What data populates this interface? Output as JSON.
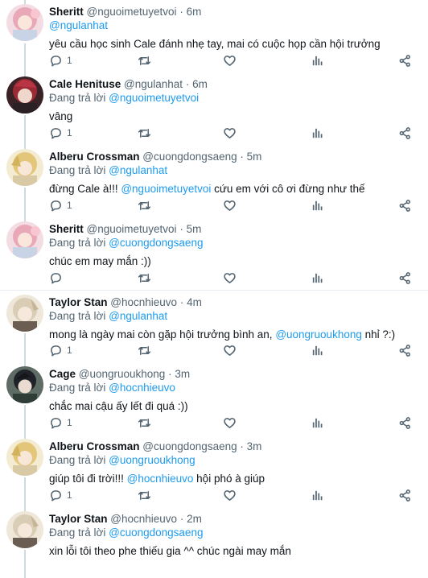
{
  "tweets": [
    {
      "name": "Sheritt",
      "handle": "@nguoimetuyetvoi",
      "time": "6m",
      "reply_prefix": "",
      "reply_to": "@ngulanhat",
      "text_parts": [
        "yêu cầu  học sinh Cale đánh nhẹ tay, mai có cuộc họp cần hội trưởng"
      ],
      "reply_count": "1",
      "avatar": "pink-haired-avatar"
    },
    {
      "name": "Cale Henituse",
      "handle": "@ngulanhat",
      "time": "6m",
      "reply_prefix": "Đang trả lời",
      "reply_to": "@nguoimetuyetvoi",
      "text_parts": [
        "vâng"
      ],
      "reply_count": "1",
      "avatar": "red-haired-avatar"
    },
    {
      "name": "Alberu Crossman",
      "handle": "@cuongdongsaeng",
      "time": "5m",
      "reply_prefix": "Đang trả lời",
      "reply_to": "@ngulanhat",
      "text_parts": [
        "đừng Cale à!!! ",
        "@nguoimetuyetvoi",
        " cứu em với cô ơi đừng như thế"
      ],
      "reply_count": "1",
      "avatar": "blonde-avatar"
    },
    {
      "name": "Sheritt",
      "handle": "@nguoimetuyetvoi",
      "time": "5m",
      "reply_prefix": "Đang trả lời",
      "reply_to": "@cuongdongsaeng",
      "text_parts": [
        "chúc em may mắn :))"
      ],
      "reply_count": "",
      "avatar": "pink-haired-avatar"
    },
    {
      "name": "Taylor Stan",
      "handle": "@hocnhieuvo",
      "time": "4m",
      "reply_prefix": "Đang trả lời",
      "reply_to": "@ngulanhat",
      "text_parts": [
        "mong là ngày mai còn gặp hội trưởng bình an, ",
        "@uongruoukhong",
        " nhỉ ?:)"
      ],
      "reply_count": "1",
      "avatar": "light-haired-avatar"
    },
    {
      "name": "Cage",
      "handle": "@uongruoukhong",
      "time": "3m",
      "reply_prefix": "Đang trả lời",
      "reply_to": "@hocnhieuvo",
      "text_parts": [
        "chắc mai cậu ấy lết đi quá :))"
      ],
      "reply_count": "1",
      "avatar": "dark-haired-avatar"
    },
    {
      "name": "Alberu Crossman",
      "handle": "@cuongdongsaeng",
      "time": "3m",
      "reply_prefix": "Đang trả lời",
      "reply_to": "@uongruoukhong",
      "text_parts": [
        "giúp tôi đi trời!!! ",
        "@hocnhieuvo",
        " hội phó à giúp"
      ],
      "reply_count": "1",
      "avatar": "blonde-avatar"
    },
    {
      "name": "Taylor Stan",
      "handle": "@hocnhieuvo",
      "time": "2m",
      "reply_prefix": "Đang trả lời",
      "reply_to": "@cuongdongsaeng",
      "text_parts": [
        "xin lỗi tôi theo phe thiếu gia ^^ chúc ngài may mắn"
      ],
      "reply_count": "",
      "avatar": "light-haired-avatar"
    }
  ],
  "icons": {
    "reply": "reply-icon",
    "retweet": "retweet-icon",
    "like": "heart-icon",
    "stats": "stats-icon",
    "share": "share-icon"
  },
  "colors": {
    "link": "#1d9bf0",
    "secondary": "#536471",
    "thread_line": "#cfd9de"
  }
}
